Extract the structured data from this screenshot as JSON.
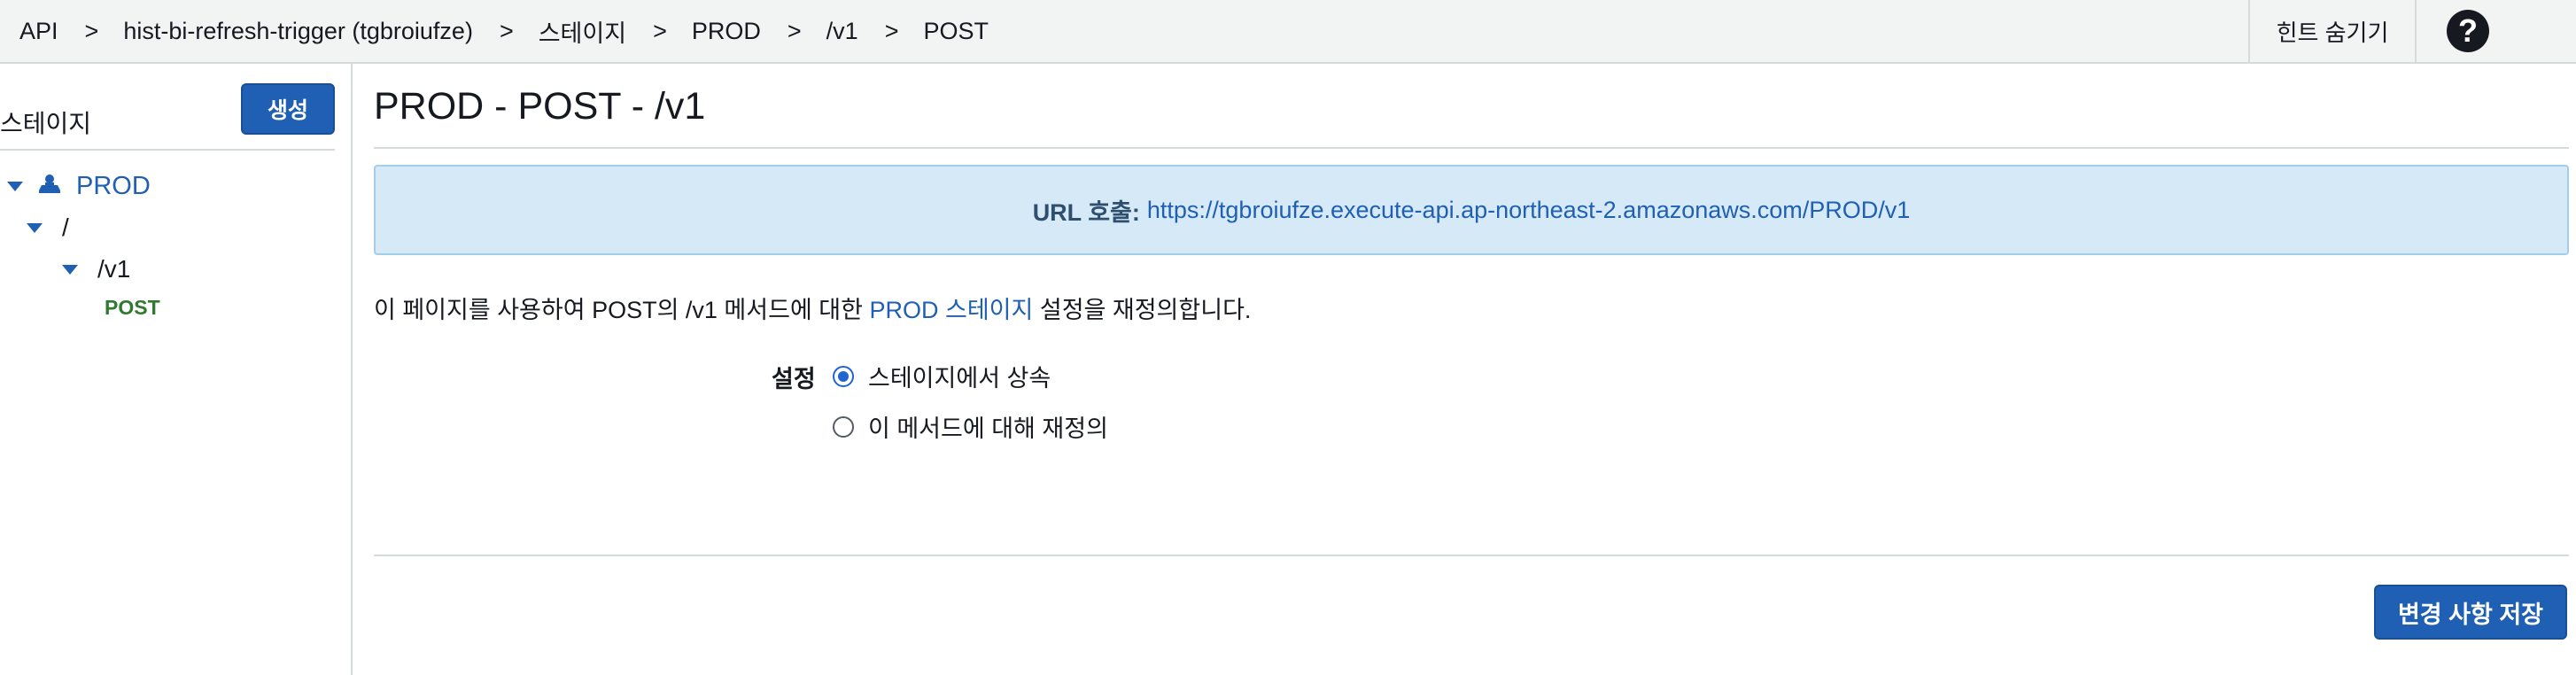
{
  "breadcrumb": {
    "items": [
      "API",
      "hist-bi-refresh-trigger (tgbroiufze)",
      "스테이지",
      "PROD",
      "/v1",
      "POST"
    ],
    "separator": ">"
  },
  "header": {
    "hint_toggle_label": "힌트 숨기기",
    "help_icon": "question-circle-icon",
    "help_glyph": "?"
  },
  "sidebar": {
    "title": "스테이지",
    "create_label": "생성",
    "tree": {
      "stage": "PROD",
      "root": "/",
      "resource": "/v1",
      "method": "POST"
    }
  },
  "main": {
    "title": "PROD - POST - /v1",
    "invoke_url_label": "URL 호출:",
    "invoke_url": "https://tgbroiufze.execute-api.ap-northeast-2.amazonaws.com/PROD/v1",
    "description": {
      "before": "이 페이지를 사용하여 POST의 /v1 메서드에 대한 ",
      "link": "PROD 스테이지",
      "after": " 설정을 재정의합니다."
    },
    "settings_label": "설정",
    "options": [
      {
        "label": "스테이지에서 상속",
        "selected": true
      },
      {
        "label": "이 메서드에 대해 재정의",
        "selected": false
      }
    ],
    "save_label": "변경 사항 저장"
  },
  "colors": {
    "primary": "#1f5fb4",
    "method_post": "#2f7a2f",
    "info_bg": "#d6e9f6",
    "topbar_bg": "#f2f3f3"
  }
}
